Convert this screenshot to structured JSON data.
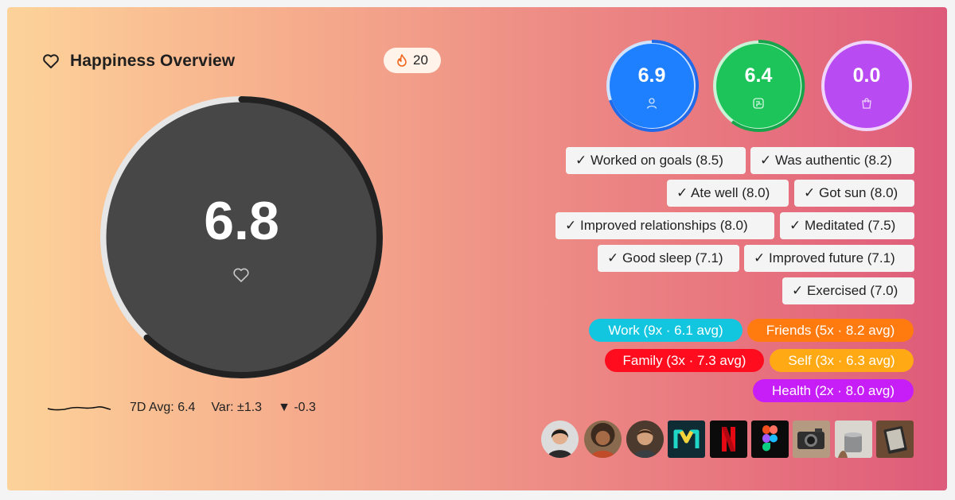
{
  "header": {
    "title": "Happiness Overview",
    "icon": "heart-icon",
    "streak": {
      "icon": "flame-icon",
      "count": "20"
    }
  },
  "main_score": {
    "value": "6.8",
    "ring_progress": 0.62,
    "icon": "heart-icon"
  },
  "stats": {
    "avg7d": "7D Avg: 6.4",
    "variance": "Var: ±1.3",
    "delta": "▼ -0.3"
  },
  "mini_scores": [
    {
      "value": "6.9",
      "icon": "person-icon",
      "color": "#1e80ff",
      "ring_color": "#a5ccff"
    },
    {
      "value": "6.4",
      "icon": "brain-icon",
      "color": "#1cc45a",
      "ring_color": "#a3eeb9"
    },
    {
      "value": "0.0",
      "icon": "bag-icon",
      "color": "#b94bf2",
      "ring_color": "#e8c3fb"
    }
  ],
  "activities": [
    "✓ Worked on goals (8.5)",
    "✓ Was authentic (8.2)",
    "✓ Ate well (8.0)",
    "✓ Got sun (8.0)",
    "✓ Improved relationships (8.0)",
    "✓ Meditated (7.5)",
    "✓ Good sleep (7.1)",
    "✓ Improved future (7.1)",
    "✓ Exercised (7.0)"
  ],
  "categories": [
    {
      "label": "Work (9x · 6.1 avg)",
      "color": "#13c6e0"
    },
    {
      "label": "Friends (5x · 8.2 avg)",
      "color": "#ff7a0f"
    },
    {
      "label": "Family (3x · 7.3 avg)",
      "color": "#ff0d1f"
    },
    {
      "label": "Self (3x · 6.3 avg)",
      "color": "#ffa914"
    },
    {
      "label": "Health (2x · 8.0 avg)",
      "color": "#c71ef7"
    }
  ],
  "people": [
    "person-1-avatar",
    "person-2-avatar",
    "person-3-avatar"
  ],
  "apps": [
    "monday-logo",
    "netflix-logo",
    "figma-logo",
    "camera-photo",
    "candle-photo",
    "kindle-photo"
  ]
}
